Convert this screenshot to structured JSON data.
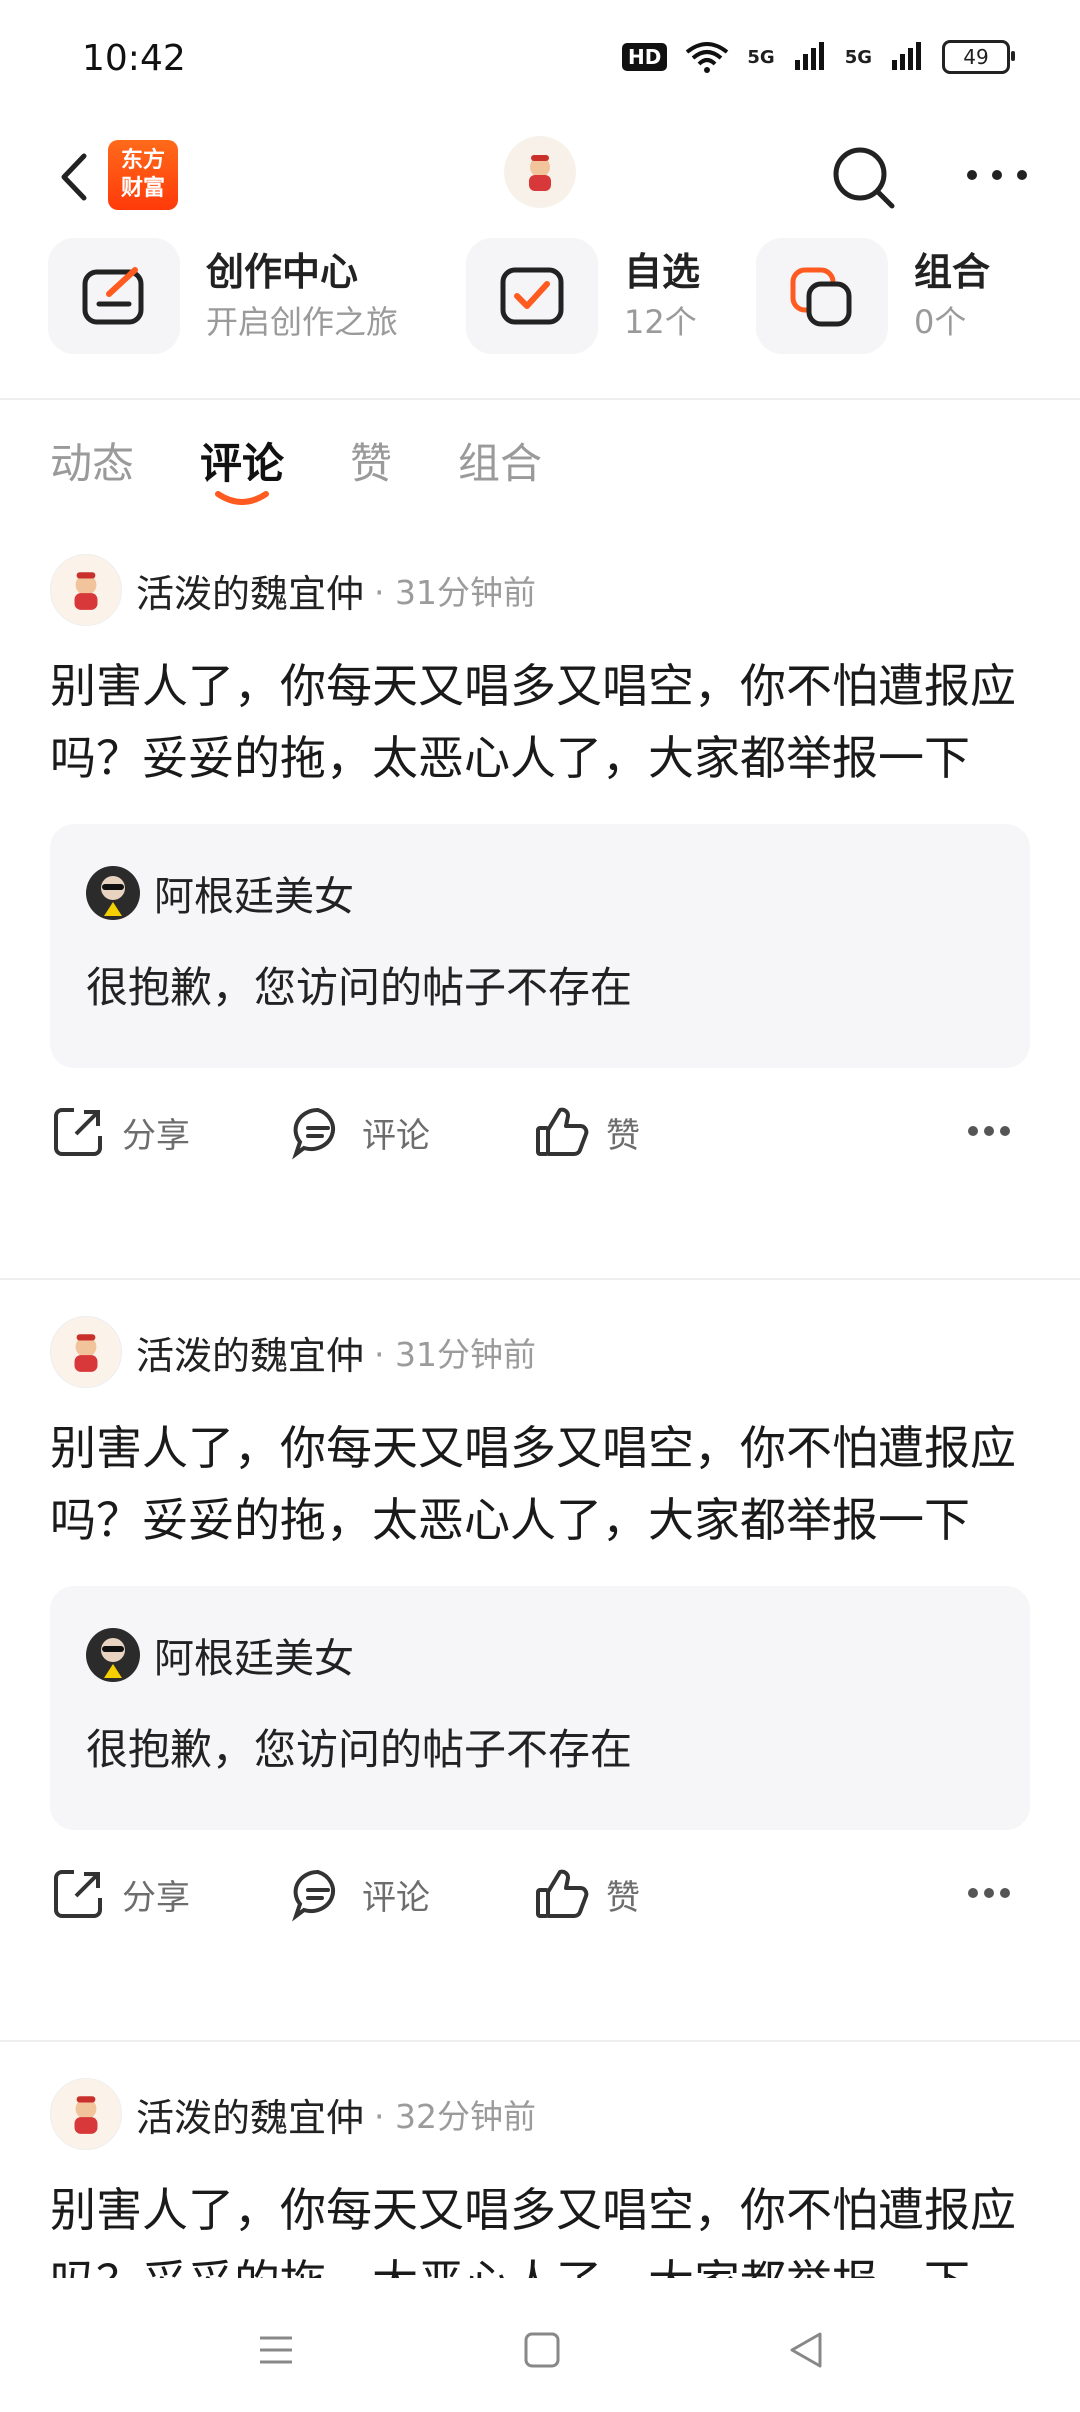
{
  "status": {
    "time": "10:42",
    "hd": "HD",
    "signal1": "5G",
    "signal2": "5G",
    "battery": "49"
  },
  "nav": {
    "logo_line1": "东方",
    "logo_line2": "财富"
  },
  "quick": [
    {
      "title": "创作中心",
      "sub": "开启创作之旅"
    },
    {
      "title": "自选",
      "sub": "12个"
    },
    {
      "title": "组合",
      "sub": "0个"
    }
  ],
  "tabs": [
    "动态",
    "评论",
    "赞",
    "组合"
  ],
  "posts": [
    {
      "author": "活泼的魏宜仲",
      "time": "· 31分钟前",
      "text": "别害人了，你每天又唱多又唱空，你不怕遭报应吗？妥妥的拖，太恶心人了，大家都举报一下",
      "quote_user": "阿根廷美女",
      "quote_text": "很抱歉，您访问的帖子不存在"
    },
    {
      "author": "活泼的魏宜仲",
      "time": "· 31分钟前",
      "text": "别害人了，你每天又唱多又唱空，你不怕遭报应吗？妥妥的拖，太恶心人了，大家都举报一下",
      "quote_user": "阿根廷美女",
      "quote_text": "很抱歉，您访问的帖子不存在"
    },
    {
      "author": "活泼的魏宜仲",
      "time": "· 32分钟前",
      "text": "别害人了，你每天又唱多又唱空，你不怕遭报应吗？妥妥的拖，太恶心人了，大家都举报一下"
    }
  ],
  "actions": {
    "share": "分享",
    "comment": "评论",
    "like": "赞"
  },
  "colors": {
    "accent": "#ff5a1f",
    "muted": "#9a9a9a"
  }
}
